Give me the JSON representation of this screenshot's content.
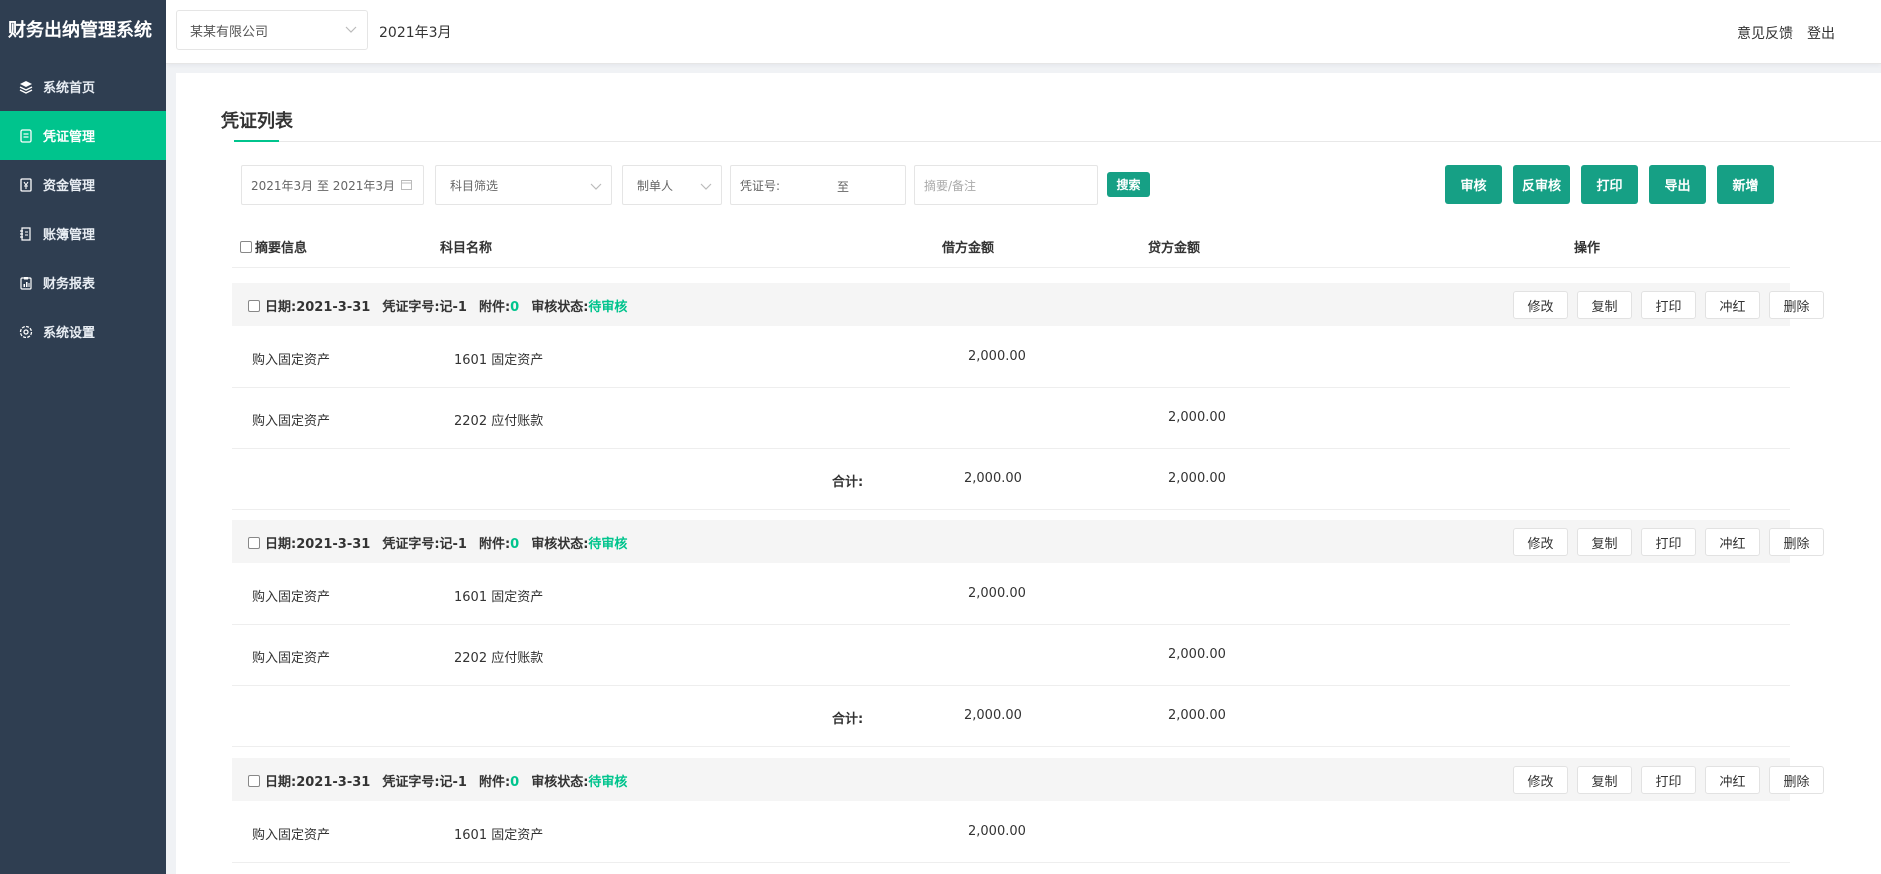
{
  "app": {
    "title": "财务出纳管理系统"
  },
  "sidebar": {
    "items": [
      {
        "label": "系统首页",
        "icon": "layers-icon"
      },
      {
        "label": "凭证管理",
        "icon": "voucher-icon",
        "active": true
      },
      {
        "label": "资金管理",
        "icon": "yuan-icon"
      },
      {
        "label": "账簿管理",
        "icon": "ledger-icon"
      },
      {
        "label": "财务报表",
        "icon": "report-icon"
      },
      {
        "label": "系统设置",
        "icon": "gear-icon"
      }
    ]
  },
  "header": {
    "company": "某某有限公司",
    "period": "2021年3月",
    "feedback": "意见反馈",
    "logout": "登出"
  },
  "page": {
    "title": "凭证列表",
    "filters": {
      "date_range": "2021年3月 至 2021年3月",
      "subject": "科目筛选",
      "maker": "制单人",
      "voucher_label": "凭证号:",
      "voucher_sep": "至",
      "memo_placeholder": "摘要/备注",
      "search": "搜索"
    },
    "actions": [
      "审核",
      "反审核",
      "打印",
      "导出",
      "新增"
    ],
    "columns": {
      "summary": "摘要信息",
      "subject": "科目名称",
      "debit": "借方金额",
      "credit": "贷方金额",
      "operation": "操作"
    },
    "row_actions": [
      "修改",
      "复制",
      "打印",
      "冲红",
      "删除"
    ],
    "labels": {
      "date": "日期:",
      "voucher_no": "凭证字号:",
      "attachment": "附件:",
      "audit_status": "审核状态:",
      "total": "合计:"
    },
    "vouchers": [
      {
        "date": "2021-3-31",
        "voucher_no": "记-1",
        "attachments": "0",
        "status": "待审核",
        "entries": [
          {
            "summary": "购入固定资产",
            "subject": "1601 固定资产",
            "debit": "2,000.00",
            "credit": ""
          },
          {
            "summary": "购入固定资产",
            "subject": "2202 应付账款",
            "debit": "",
            "credit": "2,000.00"
          }
        ],
        "total_debit": "2,000.00",
        "total_credit": "2,000.00"
      },
      {
        "date": "2021-3-31",
        "voucher_no": "记-1",
        "attachments": "0",
        "status": "待审核",
        "entries": [
          {
            "summary": "购入固定资产",
            "subject": "1601 固定资产",
            "debit": "2,000.00",
            "credit": ""
          },
          {
            "summary": "购入固定资产",
            "subject": "2202 应付账款",
            "debit": "",
            "credit": "2,000.00"
          }
        ],
        "total_debit": "2,000.00",
        "total_credit": "2,000.00"
      },
      {
        "date": "2021-3-31",
        "voucher_no": "记-1",
        "attachments": "0",
        "status": "待审核",
        "entries": [
          {
            "summary": "购入固定资产",
            "subject": "1601 固定资产",
            "debit": "2,000.00",
            "credit": ""
          }
        ]
      }
    ]
  },
  "colors": {
    "sidebar": "#2f3e51",
    "accent": "#00c48d",
    "button": "#16a085"
  }
}
